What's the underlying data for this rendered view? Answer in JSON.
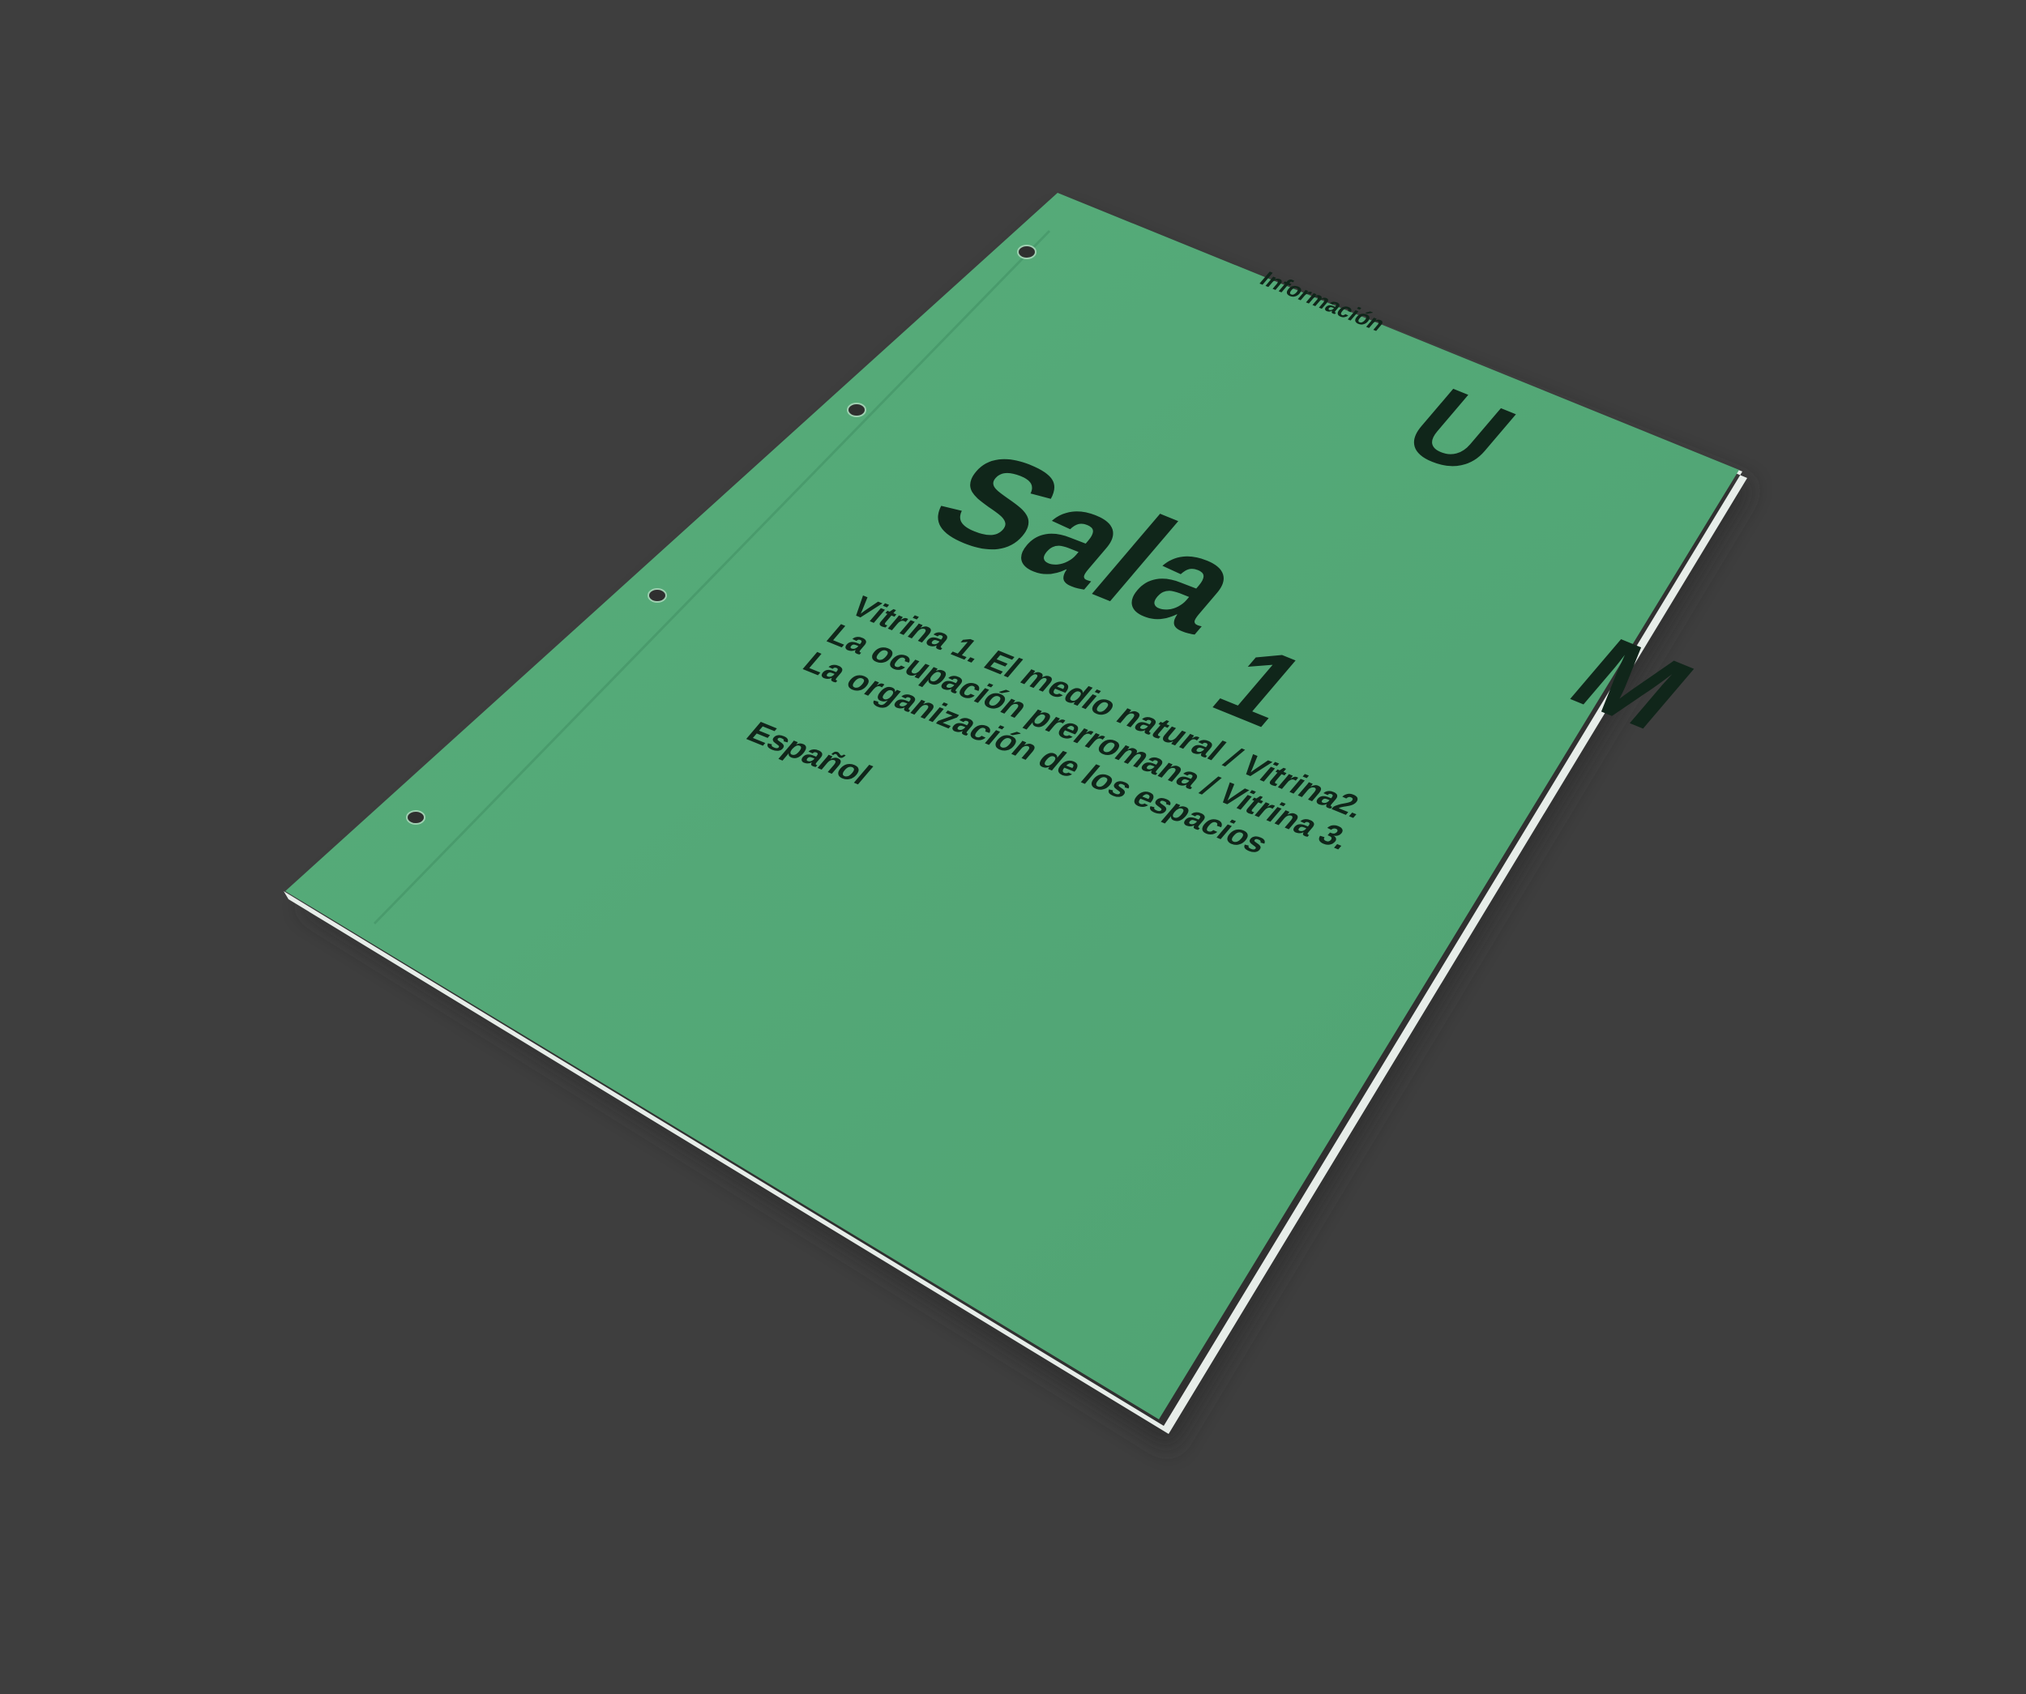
{
  "colors": {
    "background": "#3e3e3e",
    "sheet": "#52a775",
    "sheet_edge": "#e7ede9",
    "ink": "#10261a"
  },
  "sheet": {
    "label_top": "Información",
    "letter_u": "U",
    "letter_m": "M",
    "title_word": "Sala",
    "title_number": "1",
    "body_lines": [
      "Vitrina 1. El medio natural / Vitrina2.",
      "La ocupación prerromana / Vitrina 3.",
      "La organización de los espacios"
    ],
    "language": "Español"
  }
}
